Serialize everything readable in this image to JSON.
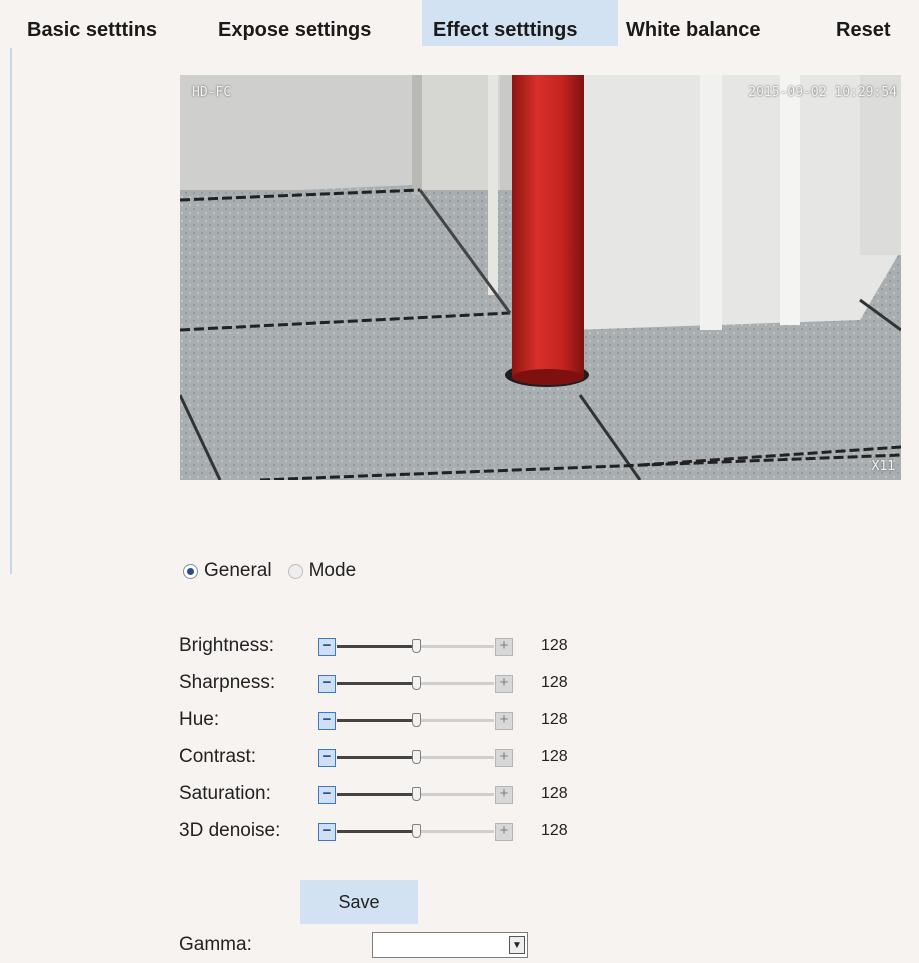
{
  "tabs": [
    {
      "label": "Basic setttins"
    },
    {
      "label": "Expose settings"
    },
    {
      "label": "Effect setttings"
    },
    {
      "label": "White balance"
    },
    {
      "label": "Reset"
    }
  ],
  "active_tab": "Effect setttings",
  "video": {
    "osd_name": "HD-FC",
    "osd_datetime": "2015-09-02 10:29:54",
    "osd_zoom": "X11"
  },
  "mode": {
    "options": [
      "General",
      "Mode"
    ],
    "selected": "General"
  },
  "sliders": [
    {
      "label": "Brightness:",
      "value": "128",
      "min": 0,
      "max": 255
    },
    {
      "label": "Sharpness:",
      "value": "128",
      "min": 0,
      "max": 255
    },
    {
      "label": "Hue:",
      "value": "128",
      "min": 0,
      "max": 255
    },
    {
      "label": "Contrast:",
      "value": "128",
      "min": 0,
      "max": 255
    },
    {
      "label": "Saturation:",
      "value": "128",
      "min": 0,
      "max": 255
    },
    {
      "label": "3D denoise:",
      "value": "128",
      "min": 0,
      "max": 255
    }
  ],
  "slider_buttons": {
    "minus": "−",
    "plus": "+"
  },
  "save_label": "Save",
  "gamma": {
    "label": "Gamma:",
    "value": "",
    "arrow": "▼"
  },
  "colors": {
    "accent": "#d3e2f3",
    "pipe": "#c8231f"
  }
}
